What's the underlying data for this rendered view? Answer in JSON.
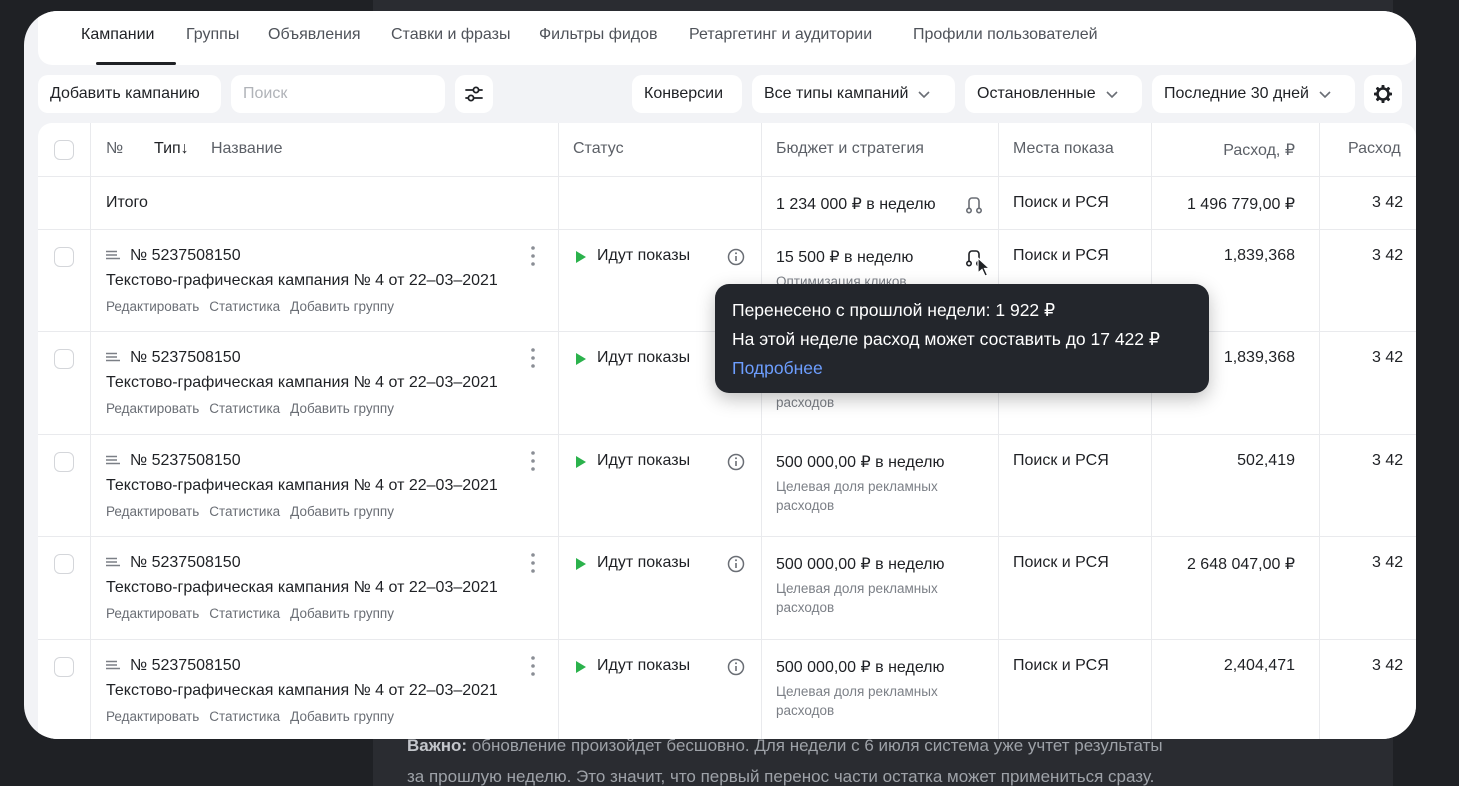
{
  "background": {
    "line1_bold": "Важно:",
    "line1_rest": " обновление произойдет бесшовно. Для недели с 6 июля система уже учтет результаты",
    "line2": "за прошлую неделю. Это значит, что первый перенос части остатка может примениться сразу."
  },
  "tabs": [
    {
      "label": "Кампании",
      "active": true
    },
    {
      "label": "Группы"
    },
    {
      "label": "Объявления"
    },
    {
      "label": "Ставки и фразы"
    },
    {
      "label": "Фильтры фидов"
    },
    {
      "label": "Ретаргетинг и аудитории"
    },
    {
      "label": "Профили пользователей"
    }
  ],
  "toolbar": {
    "add_campaign": "Добавить кампанию",
    "search_placeholder": "Поиск",
    "conversions": "Конверсии",
    "campaign_types": "Все типы кампаний",
    "status_filter": "Остановленные",
    "period": "Последние 30 дней"
  },
  "table": {
    "headers": {
      "number": "№",
      "type": "Тип↓",
      "name": "Название",
      "status": "Статус",
      "budget": "Бюджет и стратегия",
      "placements": "Места показа",
      "spend": "Расход, ₽",
      "spend2": "Расход"
    },
    "total": {
      "label": "Итого",
      "budget": "1 234 000 ₽ в неделю",
      "placements": "Поиск и РСЯ",
      "spend": "1 496 779,00 ₽",
      "spend2": "3 42"
    },
    "actions": [
      "Редактировать",
      "Статистика",
      "Добавить группу"
    ],
    "rows": [
      {
        "number": "№ 5237508150",
        "name": "Текстово-графическая кампания № 4 от 22–03–2021",
        "status": "Идут показы",
        "budget": "15 500 ₽ в неделю",
        "strategy": "Оптимизация кликов",
        "strategy2": "",
        "placements": "Поиск и РСЯ",
        "spend": "1,839,368",
        "spend2": "3 42"
      },
      {
        "number": "№ 5237508150",
        "name": "Текстово-графическая кампания № 4 от 22–03–2021",
        "status": "Идут показы",
        "budget": "",
        "strategy": "",
        "strategy2": "расходов",
        "placements": "",
        "spend": "1,839,368",
        "spend2": "3 42"
      },
      {
        "number": "№ 5237508150",
        "name": "Текстово-графическая кампания № 4 от 22–03–2021",
        "status": "Идут показы",
        "budget": "500 000,00 ₽ в неделю",
        "strategy": "Целевая доля рекламных",
        "strategy2": "расходов",
        "placements": "Поиск и РСЯ",
        "spend": "502,419",
        "spend2": "3 42"
      },
      {
        "number": "№ 5237508150",
        "name": "Текстово-графическая кампания № 4 от 22–03–2021",
        "status": "Идут показы",
        "budget": "500 000,00 ₽ в неделю",
        "strategy": "Целевая доля рекламных",
        "strategy2": "расходов",
        "placements": "Поиск и РСЯ",
        "spend": "2 648 047,00 ₽",
        "spend2": "3 42"
      },
      {
        "number": "№ 5237508150",
        "name": "Текстово-графическая кампания № 4 от 22–03–2021",
        "status": "Идут показы",
        "budget": "500 000,00 ₽ в неделю",
        "strategy": "Целевая доля рекламных",
        "strategy2": "расходов",
        "placements": "Поиск и РСЯ",
        "spend": "2,404,471",
        "spend2": "3 42"
      }
    ]
  },
  "tooltip": {
    "line1": "Перенесено с прошлой недели: 1 922 ₽",
    "line2": "На этой неделе расход может составить до 17 422 ₽",
    "link": "Подробнее"
  },
  "colors": {
    "status_active": "#2bb24c",
    "link": "#6d9eff"
  }
}
